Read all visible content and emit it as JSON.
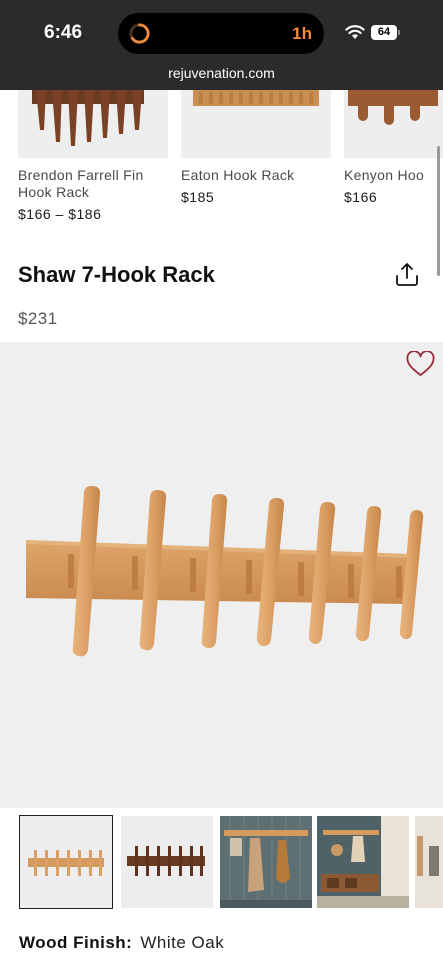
{
  "status_bar": {
    "time": "6:46",
    "island_label": "1h",
    "battery_level": "64",
    "url": "rejuvenation.com"
  },
  "related_products": [
    {
      "name": "Brendon Farrell Fin Hook Rack",
      "price": "$166 – $186"
    },
    {
      "name": "Eaton Hook Rack",
      "price": "$185"
    },
    {
      "name": "Kenyon Hoo",
      "price": "$166"
    }
  ],
  "product": {
    "title": "Shaw 7-Hook Rack",
    "price": "$231",
    "option_label": "Wood Finish:",
    "option_value": "White Oak"
  },
  "gallery": {
    "thumbnail_count": 5,
    "selected_index": 0
  },
  "colors": {
    "status_bar_bg": "#2b2b2b",
    "accent_orange": "#f08a3c",
    "heart_red": "#9b2a3a",
    "oak": "#d9a265",
    "walnut": "#6b3a22"
  },
  "icons": [
    "activity-ring-icon",
    "wifi-icon",
    "battery-icon",
    "share-icon",
    "heart-icon"
  ]
}
